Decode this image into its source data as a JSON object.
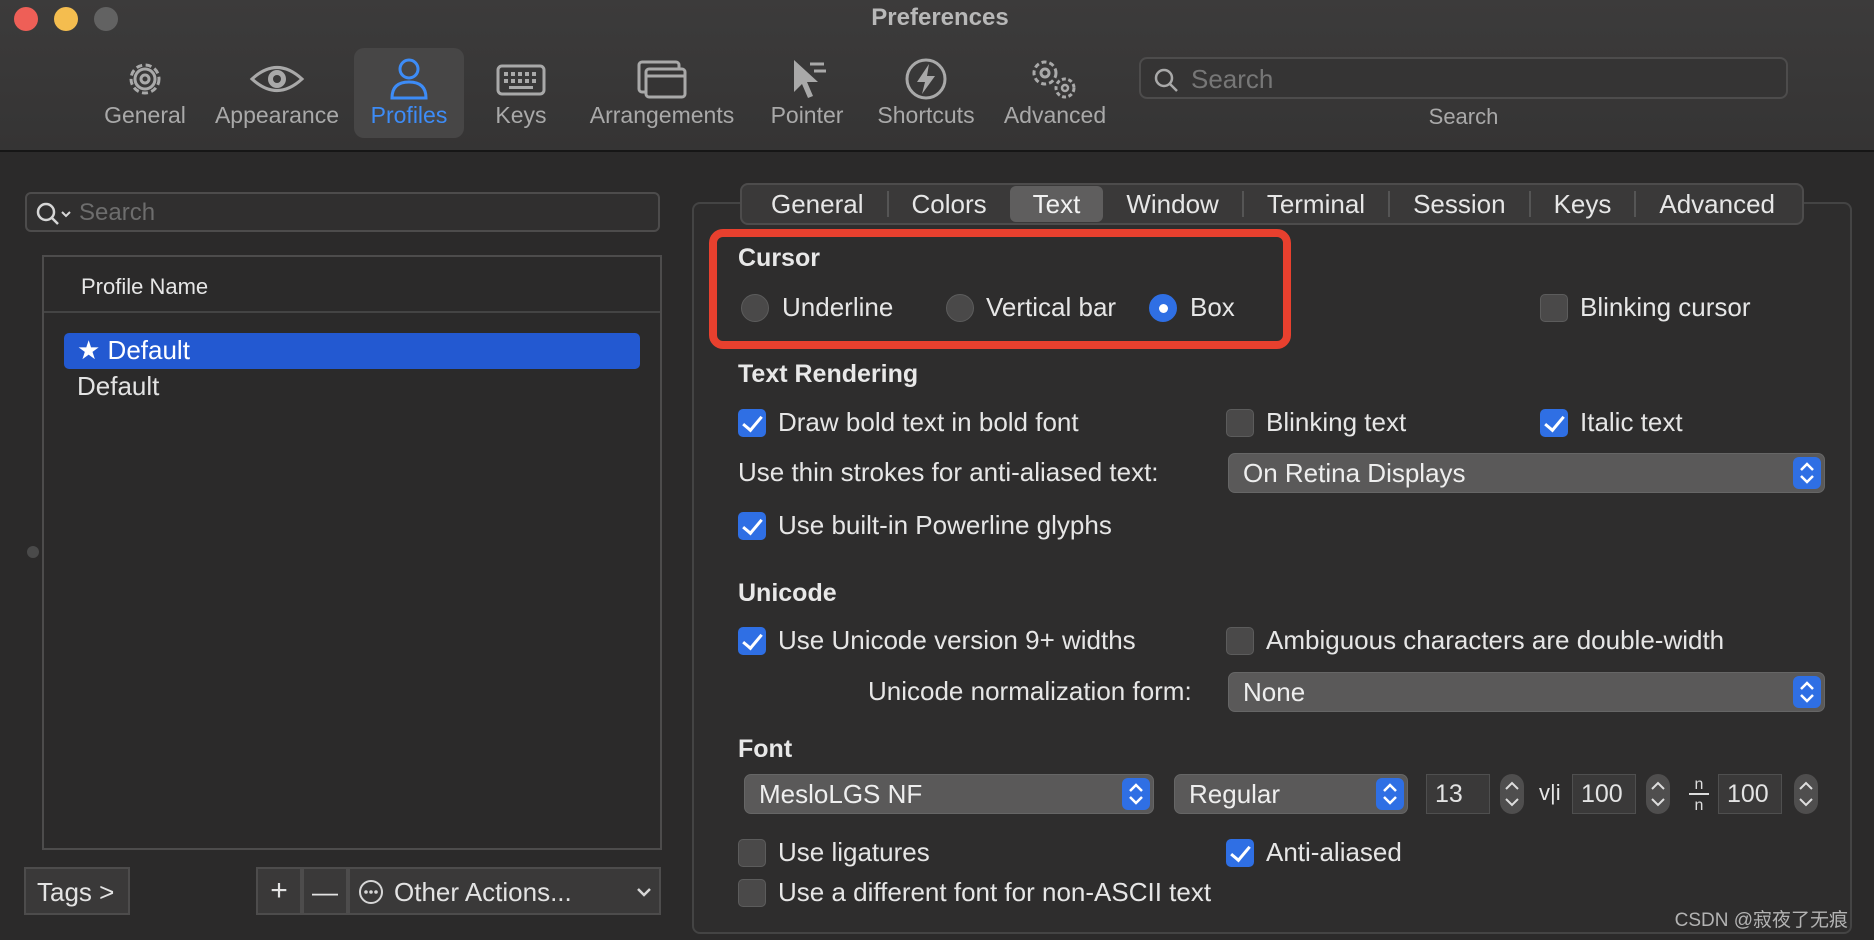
{
  "window": {
    "title": "Preferences"
  },
  "toolbar": {
    "items": [
      {
        "label": "General",
        "icon": "gear-icon"
      },
      {
        "label": "Appearance",
        "icon": "eye-icon"
      },
      {
        "label": "Profiles",
        "icon": "person-icon",
        "active": true
      },
      {
        "label": "Keys",
        "icon": "keyboard-icon"
      },
      {
        "label": "Arrangements",
        "icon": "windows-icon"
      },
      {
        "label": "Pointer",
        "icon": "pointer-icon"
      },
      {
        "label": "Shortcuts",
        "icon": "bolt-icon"
      },
      {
        "label": "Advanced",
        "icon": "gears-icon"
      }
    ],
    "search_placeholder": "Search",
    "search_caption": "Search"
  },
  "profiles": {
    "search_placeholder": "Search",
    "column_header": "Profile Name",
    "rows": [
      "Default",
      "Default"
    ]
  },
  "bottom": {
    "tags": "Tags >",
    "add": "+",
    "remove": "—",
    "other_actions": "Other Actions..."
  },
  "tabs": [
    "General",
    "Colors",
    "Text",
    "Window",
    "Terminal",
    "Session",
    "Keys",
    "Advanced"
  ],
  "active_tab": "Text",
  "cursor": {
    "title": "Cursor",
    "underline": "Underline",
    "vertical_bar": "Vertical bar",
    "box": "Box",
    "selected": "Box",
    "blinking": "Blinking cursor"
  },
  "text_rendering": {
    "title": "Text Rendering",
    "bold": "Draw bold text in bold font",
    "blinking_text": "Blinking text",
    "italic": "Italic text",
    "thin_strokes_label": "Use thin strokes for anti-aliased text:",
    "thin_strokes_value": "On Retina Displays",
    "powerline": "Use built-in Powerline glyphs"
  },
  "unicode": {
    "title": "Unicode",
    "widths": "Use Unicode version 9+ widths",
    "ambiguous": "Ambiguous characters are double-width",
    "normalization_label": "Unicode normalization form:",
    "normalization_value": "None"
  },
  "font": {
    "title": "Font",
    "family": "MesloLGS NF",
    "style": "Regular",
    "size": "13",
    "h_spacing_icon": "v|i",
    "h_spacing": "100",
    "v_spacing_icon": "n/n",
    "v_spacing": "100",
    "ligatures": "Use ligatures",
    "anti_aliased": "Anti-aliased",
    "non_ascii": "Use a different font for non-ASCII text"
  },
  "watermark": "CSDN @寂夜了无痕",
  "colors": {
    "accent": "#2f6fe4",
    "selection": "#2359d1",
    "highlight": "#e8402e"
  }
}
